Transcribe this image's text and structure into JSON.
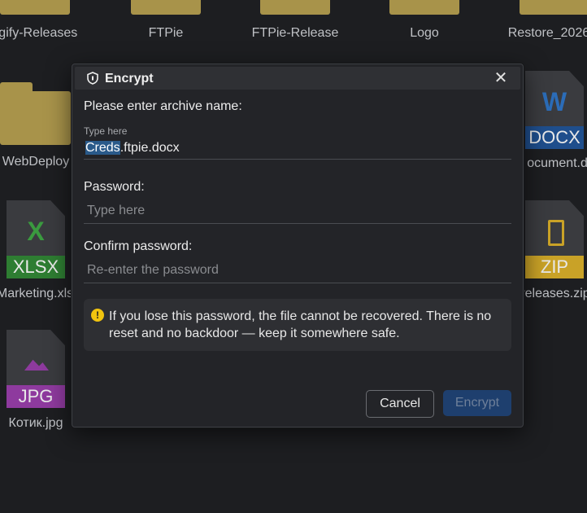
{
  "background": {
    "items": [
      {
        "label": "lgify-Releases"
      },
      {
        "label": "FTPie"
      },
      {
        "label": "FTPie-Release"
      },
      {
        "label": "Logo"
      },
      {
        "label": "Restore_2026"
      },
      {
        "label": "WebDeploy"
      },
      {
        "label": "ocument.do"
      },
      {
        "label": "Marketing.xls"
      },
      {
        "label": "releases.zip"
      },
      {
        "label": "Котик.jpg"
      }
    ],
    "badges": {
      "docx": "DOCX",
      "xlsx": "XLSX",
      "zip": "ZIP",
      "jpg": "JPG",
      "word_letter": "W",
      "excel_letter": "X"
    }
  },
  "dialog": {
    "title": "Encrypt",
    "archive_label": "Please enter archive name:",
    "archive_hint": "Type here",
    "archive_selected": "Creds",
    "archive_rest": ".ftpie.docx",
    "password_label": "Password:",
    "password_placeholder": "Type here",
    "confirm_label": "Confirm password:",
    "confirm_placeholder": "Re-enter the password",
    "warning": "If you lose this password, the file cannot be recovered. There is no reset and no backdoor — keep it somewhere safe.",
    "cancel_label": "Cancel",
    "encrypt_label": "Encrypt"
  },
  "colors": {
    "folder": "#a8934a",
    "accent": "#2a5a8a",
    "warning": "#f1c40f",
    "docx": "#1f4e8c",
    "xlsx": "#2e7d32",
    "zip": "#c9a227",
    "jpg": "#8e3a9e"
  }
}
